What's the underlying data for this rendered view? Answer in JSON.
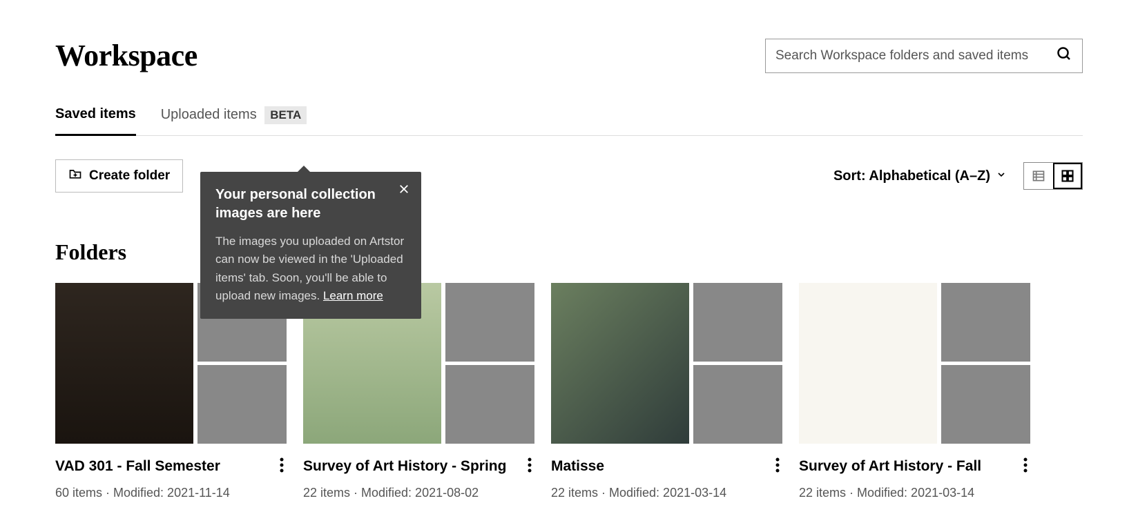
{
  "page_title": "Workspace",
  "search": {
    "placeholder": "Search Workspace folders and saved items"
  },
  "tabs": {
    "saved": "Saved items",
    "uploaded": "Uploaded items",
    "beta_badge": "BETA"
  },
  "toolbar": {
    "create_label": "Create folder",
    "sort_label": "Sort: Alphabetical (A–Z)"
  },
  "section_heading": "Folders",
  "tooltip": {
    "title": "Your personal collection images are here",
    "body": "The images you uploaded on Artstor can now be viewed in the 'Uploaded items' tab. Soon, you'll be able to upload new images. ",
    "link_text": "Learn more"
  },
  "folders": [
    {
      "title": "VAD 301 - Fall Semester",
      "meta": "60 items · Modified: 2021-11-14"
    },
    {
      "title": "Survey of Art History - Spring",
      "meta": "22 items · Modified: 2021-08-02"
    },
    {
      "title": "Matisse",
      "meta": "22 items · Modified: 2021-03-14"
    },
    {
      "title": "Survey of Art History - Fall",
      "meta": "22 items · Modified: 2021-03-14"
    }
  ]
}
